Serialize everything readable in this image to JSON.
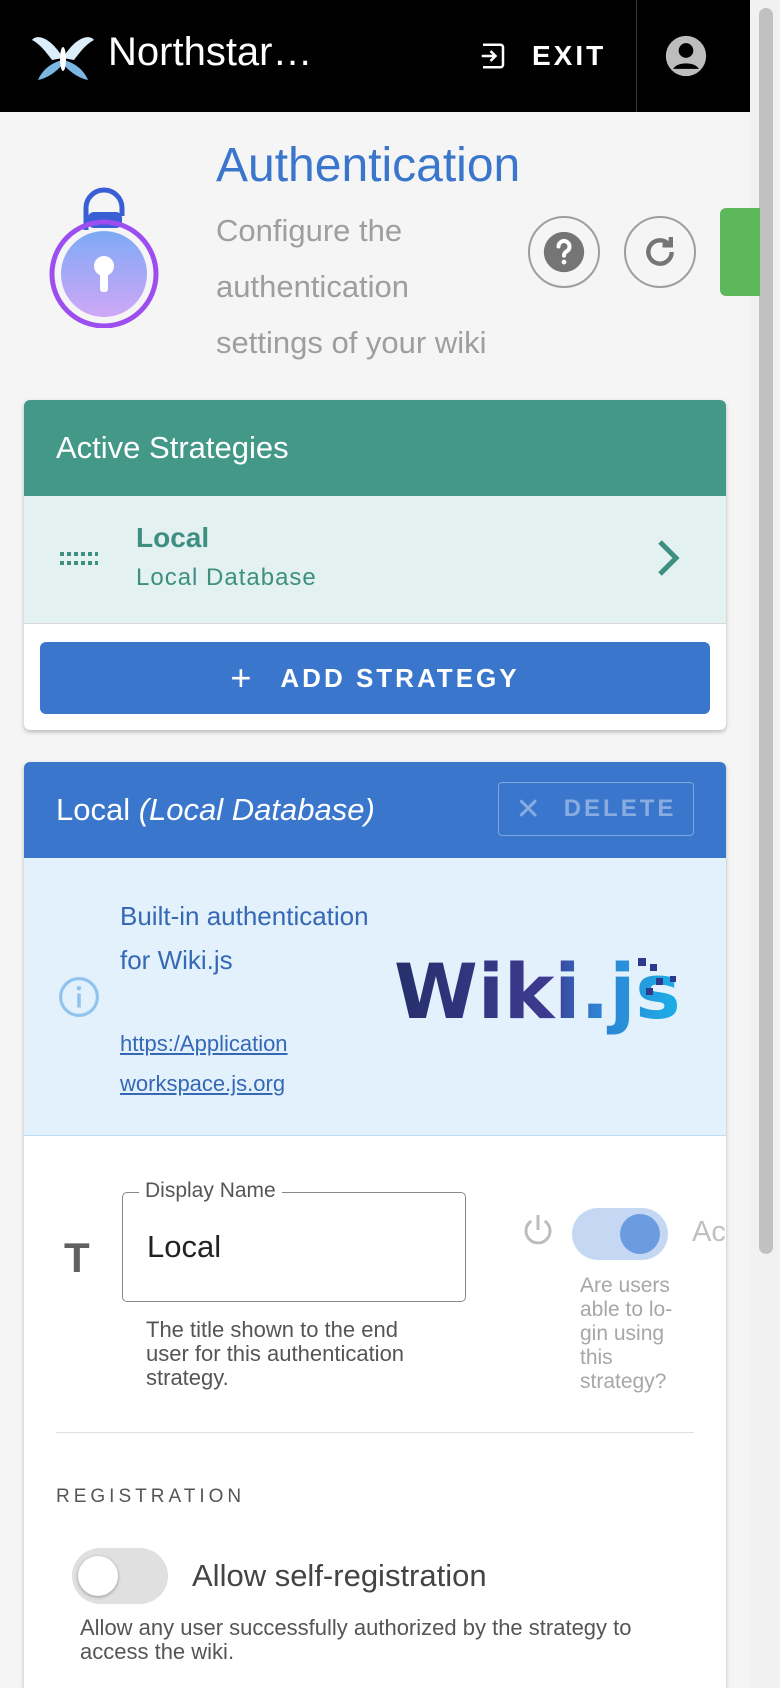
{
  "app": {
    "title": "Northstar…",
    "exit_label": "EXIT"
  },
  "header": {
    "title": "Authentication",
    "subtitle": "Configure the authentication settings of your wiki"
  },
  "active_strategies": {
    "title": "Active Strategies",
    "items": [
      {
        "title": "Local",
        "subtitle": "Local Database"
      }
    ],
    "add_label": "ADD STRATEGY"
  },
  "strategy_detail": {
    "title": "Local",
    "title_detail": "(Local Database)",
    "delete_label": "DELETE",
    "info_text": "Built-in authentication for Wiki.js",
    "info_link": "https:/Application workspace.js.org",
    "logo_text": "Wiki.js",
    "display_name": {
      "label": "Display Name",
      "value": "Local",
      "hint": "The title shown to the end user for this authentication strategy."
    },
    "active": {
      "label": "Active",
      "hint": "Are users able to lo-gin using this strategy?",
      "enabled": true
    },
    "registration": {
      "section_label": "REGISTRATION",
      "self_registration_label": "Allow self-registration",
      "self_registration_hint": "Allow any user successfully authorized by the strategy to access the wiki.",
      "enabled": false
    }
  },
  "colors": {
    "teal": "#439888",
    "blue": "#3a76cc",
    "green": "#5db85c"
  }
}
